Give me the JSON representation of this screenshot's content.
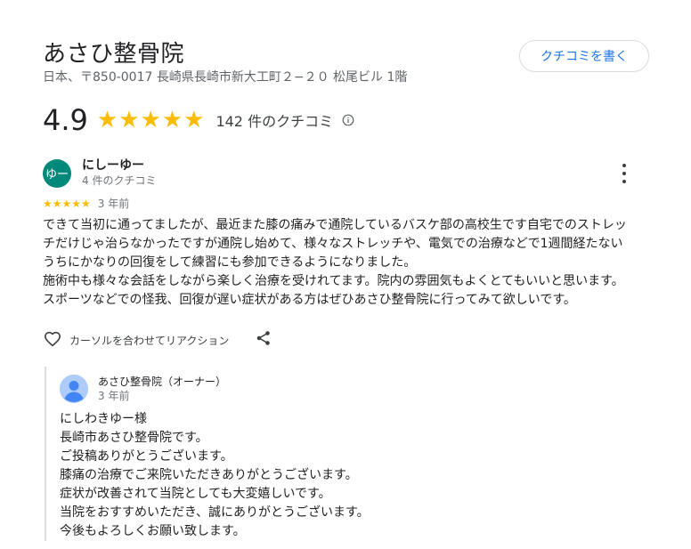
{
  "business": {
    "name": "あさひ整骨院",
    "address": "日本、〒850-0017 長崎県長崎市新大工町２−２０ 松尾ビル 1階",
    "write_review_label": "クチコミを書く",
    "rating": "4.9",
    "stars": "★★★★★",
    "review_count": "142 件のクチコミ"
  },
  "review": {
    "avatar_text": "ゆー",
    "avatar_color": "#00897b",
    "author": "にしーゆー",
    "author_reviews": "4 件のクチコミ",
    "stars": "★★★★★",
    "time": "3 年前",
    "lines": [
      "できて当初に通ってましたが、最近また膝の痛みで通院しているバスケ部の高校生です自宅でのストレッ",
      "チだけじゃ治らなかったですが通院し始めて、様々なストレッチや、電気での治療などで1週間経たない",
      "うちにかなりの回復をして練習にも参加できるようになりました。",
      "施術中も様々な会話をしながら楽しく治療を受けれてます。院内の雰囲気もよくとてもいいと思います。",
      "スポーツなどでの怪我、回復が遅い症状がある方はぜひあさひ整骨院に行ってみて欲しいです。"
    ],
    "like_label": "カーソルを合わせてリアクション"
  },
  "owner_reply": {
    "name": "あさひ整骨院（オーナー）",
    "time": "3 年前",
    "lines": [
      "にしわきゆー様",
      "長崎市あさひ整骨院です。",
      "ご投稿ありがとうございます。",
      "膝痛の治療でご来院いただきありがとうございます。",
      "症状が改善されて当院としても大変嬉しいです。",
      "当院をおすすめいただき、誠にありがとうございます。",
      "今後もよろしくお願い致します。"
    ]
  },
  "colors": {
    "star": "#fbbc04",
    "link_blue": "#1a73e8"
  }
}
